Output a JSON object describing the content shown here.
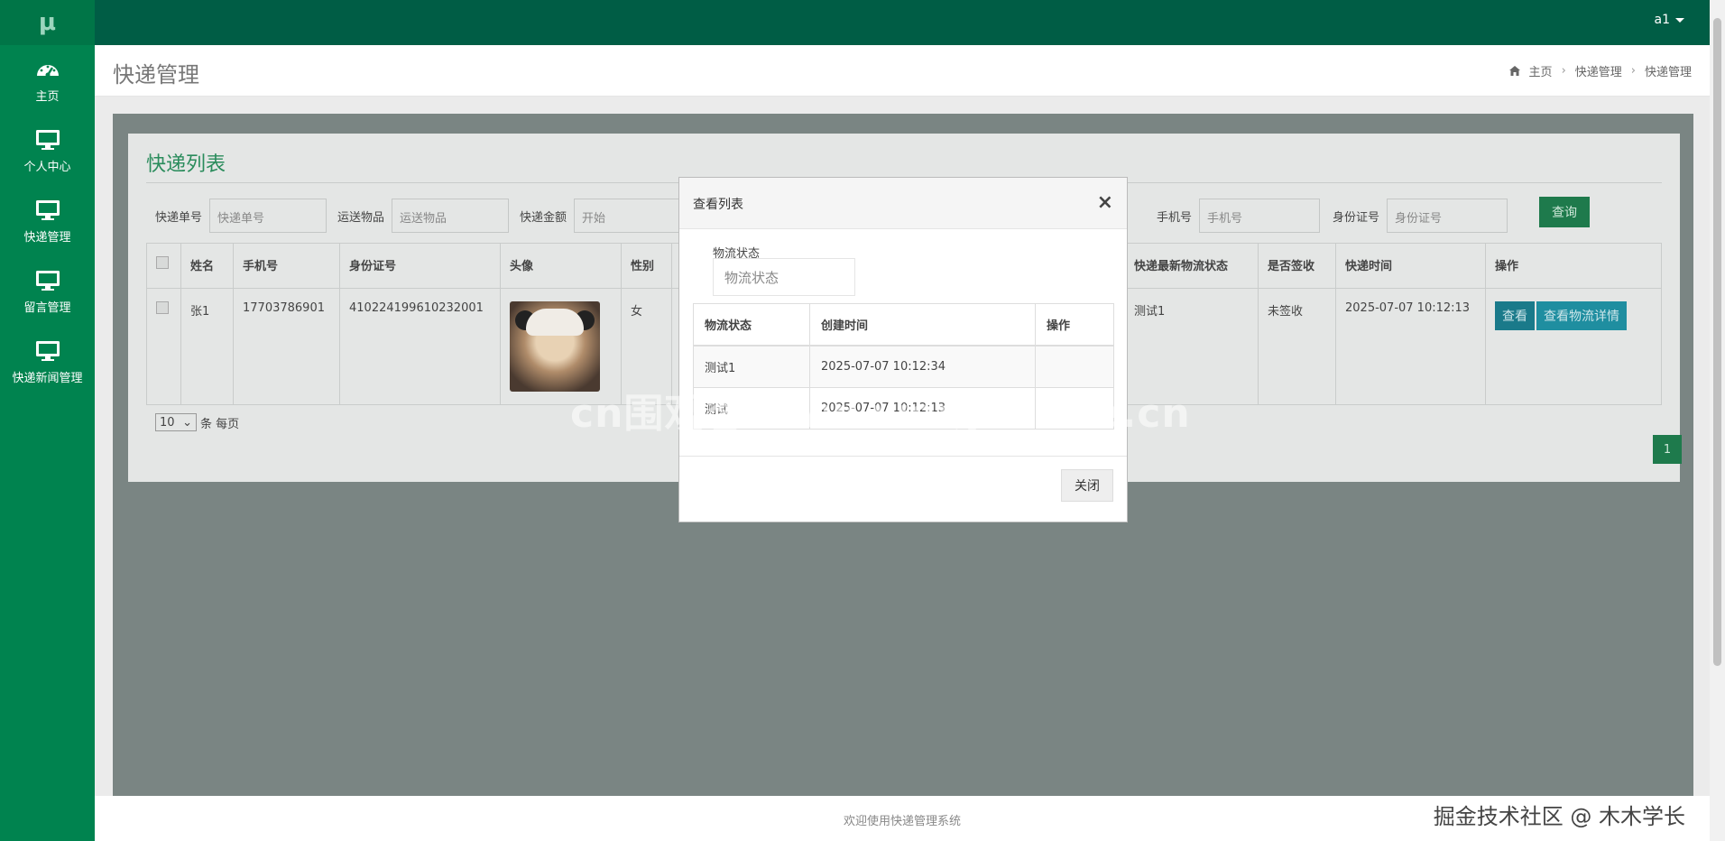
{
  "app": {
    "logo": "μ",
    "user": "a1"
  },
  "sidebar": {
    "items": [
      {
        "label": "主页",
        "icon": "dashboard-icon"
      },
      {
        "label": "个人中心",
        "icon": "monitor-icon"
      },
      {
        "label": "快递管理",
        "icon": "monitor-icon"
      },
      {
        "label": "留言管理",
        "icon": "monitor-icon"
      },
      {
        "label": "快递新闻管理",
        "icon": "monitor-icon"
      }
    ]
  },
  "header": {
    "title": "快递管理",
    "breadcrumb": [
      "主页",
      "快递管理",
      "快递管理"
    ]
  },
  "panel": {
    "title": "快递列表",
    "filters": [
      {
        "label": "快递单号",
        "placeholder": "快递单号"
      },
      {
        "label": "运送物品",
        "placeholder": "运送物品"
      },
      {
        "label": "快递金额",
        "placeholder": "开始"
      }
    ],
    "filters_right": [
      {
        "label": "手机号",
        "placeholder": "手机号"
      },
      {
        "label": "身份证号",
        "placeholder": "身份证号"
      }
    ],
    "search_label": "查询",
    "table": {
      "headers": [
        "姓名",
        "手机号",
        "身份证号",
        "头像",
        "性别",
        "快递最新物流状态",
        "是否签收",
        "快递时间",
        "操作"
      ],
      "rows": [
        {
          "name": "张1",
          "phone": "17703786901",
          "id_card": "410224199610232001",
          "gender": "女",
          "latest_status": "测试1",
          "signed": "未签收",
          "time": "2025-07-07 10:12:13",
          "view_label": "查看",
          "detail_label": "查看物流详情"
        }
      ]
    },
    "page_size": "10",
    "page_size_suffix": "条 每页",
    "current_page": "1"
  },
  "modal": {
    "title": "查看列表",
    "close_symbol": "×",
    "status_label": "物流状态",
    "status_placeholder": "物流状态",
    "table": {
      "headers": [
        "物流状态",
        "创建时间",
        "操作"
      ],
      "rows": [
        {
          "status": "测试1",
          "created": "2025-07-07 10:12:34"
        },
        {
          "status": "测试",
          "created": "2025-07-07 10:12:13"
        }
      ]
    },
    "close_label": "关闭"
  },
  "watermark": "cn围观客www.weiguanke.cn",
  "footer": {
    "text": "欢迎使用快递管理系统",
    "credit": "掘金技术社区 @ 木木学长"
  },
  "colors": {
    "sidebar": "#00834f",
    "topbar": "#005d45",
    "accent": "#1e7a4c"
  }
}
